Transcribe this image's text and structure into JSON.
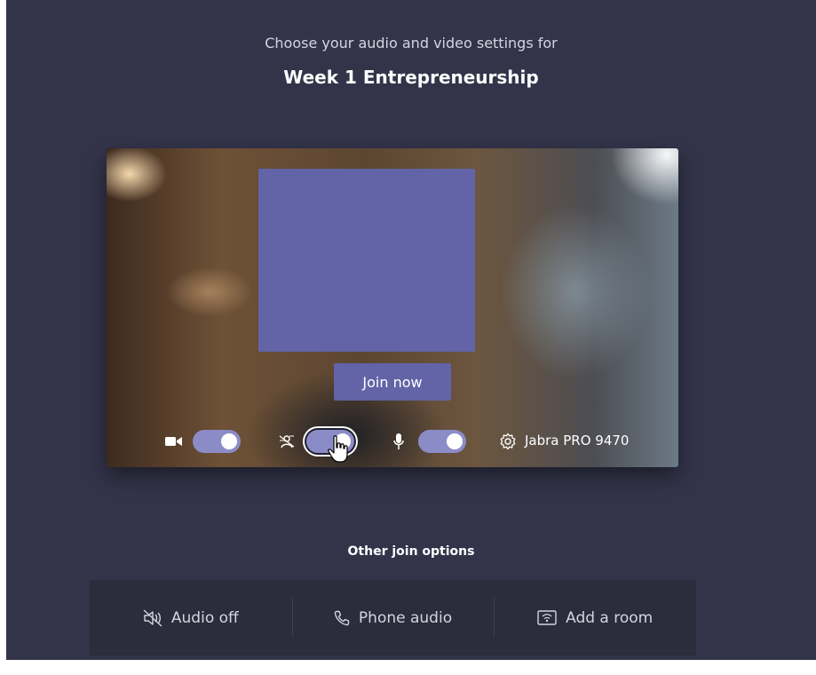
{
  "header": {
    "subtitle": "Choose your audio and video settings for",
    "meeting_title": "Week 1 Entrepreneurship"
  },
  "preview": {
    "join_label": "Join now",
    "controls": {
      "camera": {
        "icon": "video-camera-icon",
        "toggle_on": true
      },
      "background_blur": {
        "icon": "background-blur-icon",
        "toggle_on": true
      },
      "microphone": {
        "icon": "microphone-icon",
        "toggle_on": true
      },
      "device": {
        "icon": "gear-icon",
        "label": "Jabra PRO 9470"
      }
    }
  },
  "other_options": {
    "title": "Other join options",
    "items": [
      {
        "label": "Audio off",
        "icon": "speaker-off-icon"
      },
      {
        "label": "Phone audio",
        "icon": "phone-icon"
      },
      {
        "label": "Add a room",
        "icon": "room-cast-icon"
      }
    ]
  },
  "colors": {
    "background": "#33344a",
    "accent": "#6264a7",
    "toggle_on": "#8b8cc7",
    "options_panel": "#2b2c3c"
  }
}
